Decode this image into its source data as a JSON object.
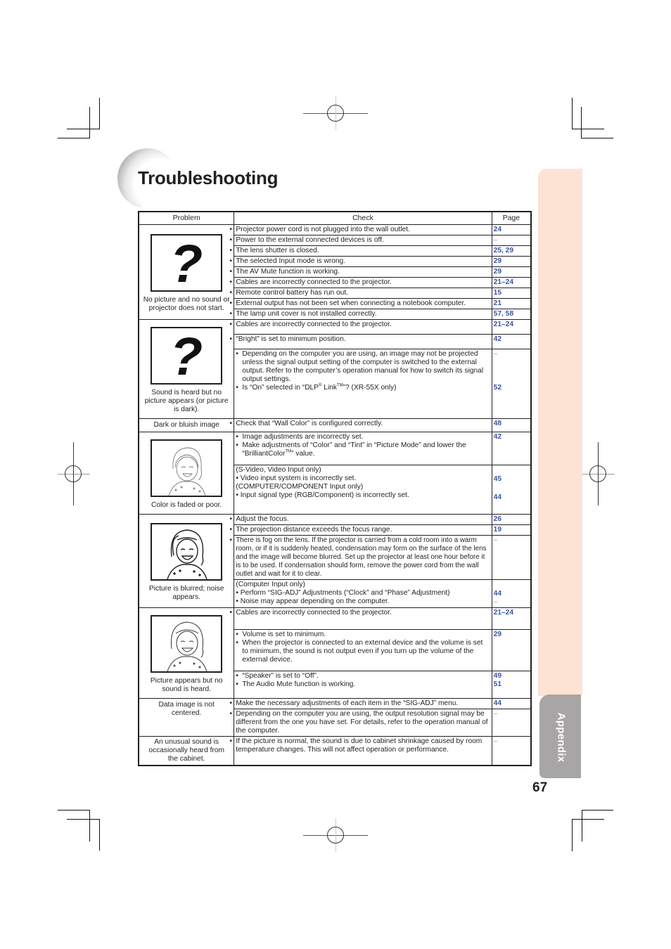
{
  "page": {
    "title": "Troubleshooting",
    "section_tab": "Appendix",
    "page_number": "67"
  },
  "table": {
    "headers": {
      "problem": "Problem",
      "check": "Check",
      "page": "Page"
    },
    "groups": [
      {
        "problem": "No picture and no sound or projector does not start.",
        "illustration": "question-mark",
        "rows": [
          {
            "check": [
              "Projector power cord is not plugged into the wall outlet."
            ],
            "pages": [
              "24"
            ]
          },
          {
            "check": [
              "Power to the external connected devices is off."
            ],
            "pages": [
              "–"
            ]
          },
          {
            "check": [
              "The lens shutter is closed."
            ],
            "pages": [
              "25, 29"
            ]
          },
          {
            "check": [
              "The selected Input mode is wrong."
            ],
            "pages": [
              "29"
            ]
          },
          {
            "check": [
              "The AV Mute function is working."
            ],
            "pages": [
              "29"
            ]
          },
          {
            "check": [
              "Cables are incorrectly connected to the projector."
            ],
            "pages": [
              "21–24"
            ]
          },
          {
            "check": [
              "Remote control battery has run out."
            ],
            "pages": [
              "15"
            ]
          },
          {
            "check": [
              "External output has not been set when connecting a notebook computer."
            ],
            "pages": [
              "21"
            ]
          },
          {
            "check": [
              "The lamp unit cover is not installed correctly."
            ],
            "pages": [
              "57, 58"
            ]
          }
        ]
      },
      {
        "problem": "Sound is heard but no picture appears (or picture is dark).",
        "illustration": "question-mark",
        "rows": [
          {
            "check": [
              "Cables are incorrectly connected to the projector."
            ],
            "pages": [
              "21–24"
            ]
          },
          {
            "check": [
              "“Bright” is set to minimum position."
            ],
            "pages": [
              "42"
            ]
          },
          {
            "check": [
              "Depending on the computer you are using, an image may not be projected unless the signal output setting of the computer is switched to the external output. Refer to the computer’s operation manual for how to switch its signal output settings.",
              "Is “On” selected in “DLP® Link™”? (XR-55X only)"
            ],
            "pages": [
              "–",
              "52"
            ]
          }
        ]
      },
      {
        "problem": "Dark or bluish image",
        "rows": [
          {
            "check": [
              "Check that “Wall Color” is configured correctly."
            ],
            "pages": [
              "48"
            ]
          }
        ]
      },
      {
        "problem": "Color is faded or poor.",
        "illustration": "faded-girl",
        "rows": [
          {
            "check": [
              "Image adjustments are incorrectly set.",
              "Make adjustments of “Color” and “Tint” in “Picture Mode” and lower the “BrilliantColor™” value."
            ],
            "pages": [
              "42"
            ]
          },
          {
            "check_lines": [
              "(S-Video, Video Input only)",
              "• Video input system is incorrectly set.",
              "(COMPUTER/COMPONENT Input only)",
              "• Input signal type (RGB/Component) is incorrectly set."
            ],
            "pages": [
              "45",
              "44"
            ]
          }
        ]
      },
      {
        "problem": "Picture is blurred; noise appears.",
        "illustration": "blurred-girl",
        "rows": [
          {
            "check": [
              "Adjust the focus."
            ],
            "pages": [
              "26"
            ]
          },
          {
            "check": [
              "The projection distance exceeds the focus range."
            ],
            "pages": [
              "19"
            ]
          },
          {
            "check": [
              "There is fog on the lens. If the projector is carried from a cold room into a warm room, or if it is suddenly heated, condensation may form on the surface of the lens and the image will become blurred. Set up the projector at least one hour before it is to be used. If condensation should form, remove the power cord from the wall outlet and wait for it to clear."
            ],
            "pages": [
              "–"
            ]
          },
          {
            "check_lines": [
              "(Computer Input only)",
              "• Perform “SIG-ADJ” Adjustments (“Clock” and “Phase” Adjustment)",
              "• Noise may appear depending on the computer."
            ],
            "pages": [
              "44",
              "–"
            ]
          }
        ]
      },
      {
        "problem": "Picture appears but no sound is heard.",
        "illustration": "girl",
        "rows": [
          {
            "check": [
              "Cables are incorrectly connected to the projector."
            ],
            "pages": [
              "21–24"
            ]
          },
          {
            "check": [
              "Volume is set to minimum.",
              "When the projector is connected to an external device and the volume is set to minimum, the sound is not output even if you turn up the volume of the external device."
            ],
            "pages": [
              "29"
            ]
          },
          {
            "check": [
              "“Speaker” is set to “Off”.",
              "The Audio Mute function is working."
            ],
            "pages": [
              "49",
              "51"
            ]
          }
        ]
      },
      {
        "problem": "Data image is not centered.",
        "rows": [
          {
            "check": [
              "Make the necessary adjustments of each item in the “SIG-ADJ” menu."
            ],
            "pages": [
              "44"
            ]
          },
          {
            "check": [
              "Depending on the computer you are using, the output resolution signal may be different from the one you have set. For details, refer to the operation manual of the computer."
            ],
            "pages": [
              "–"
            ]
          }
        ]
      },
      {
        "problem": "An unusual sound is occasionally heard from the cabinet.",
        "rows": [
          {
            "check": [
              "If the picture is normal, the sound is due to cabinet shrinkage caused by room temperature changes. This will not affect operation or performance."
            ],
            "pages": [
              "–"
            ]
          }
        ]
      }
    ]
  }
}
